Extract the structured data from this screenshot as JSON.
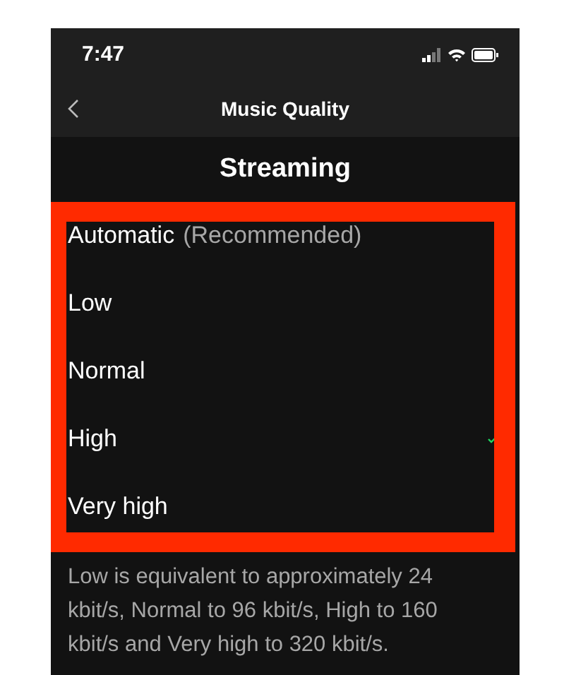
{
  "status_bar": {
    "time": "7:47"
  },
  "nav": {
    "title": "Music Quality"
  },
  "section": {
    "title": "Streaming"
  },
  "options": [
    {
      "label": "Automatic",
      "note": "(Recommended)",
      "selected": false
    },
    {
      "label": "Low",
      "selected": false
    },
    {
      "label": "Normal",
      "selected": false
    },
    {
      "label": "High",
      "selected": true
    },
    {
      "label": "Very high",
      "selected": false
    }
  ],
  "footnote": "Low is equivalent to approximately 24 kbit/s, Normal to 96 kbit/s, High to 160 kbit/s and Very high to 320 kbit/s."
}
